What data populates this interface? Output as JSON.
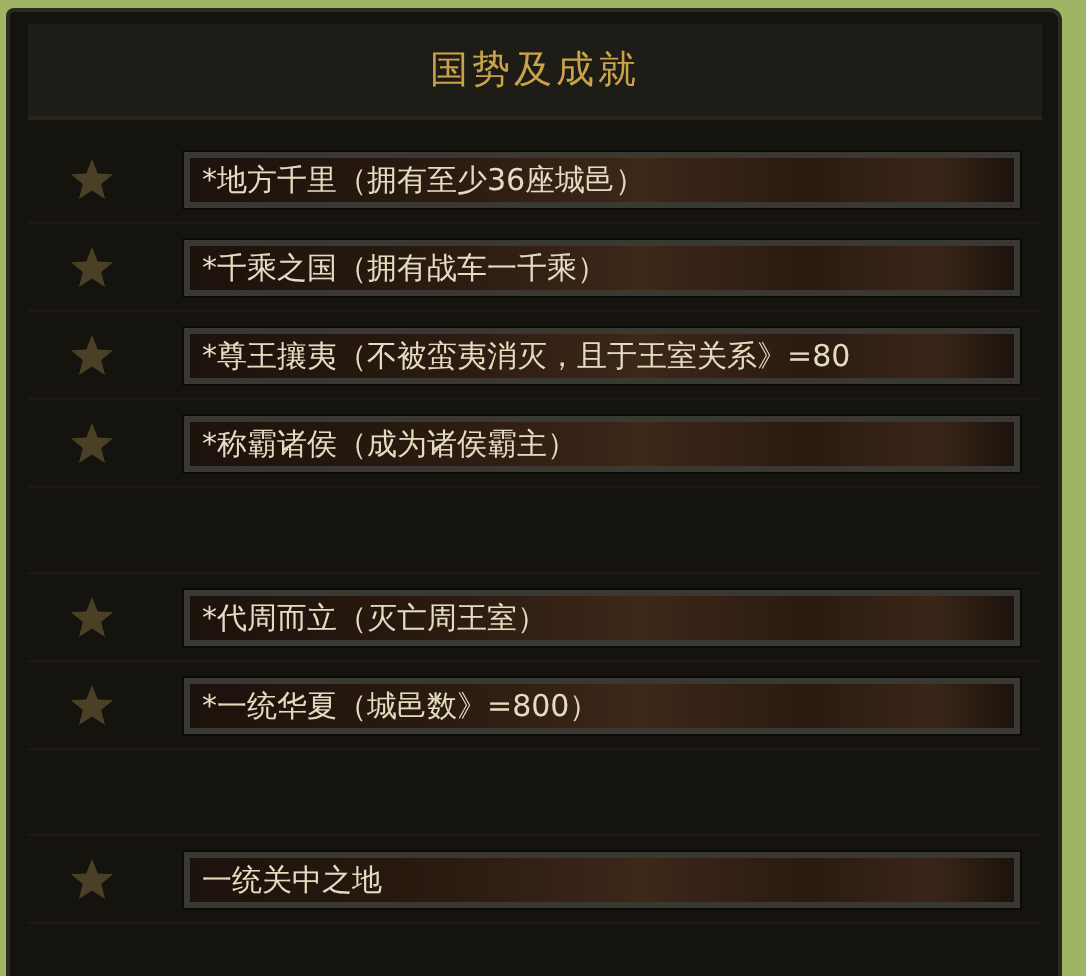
{
  "title": "国势及成就",
  "rows": [
    {
      "kind": "achievement",
      "label": "*地方千里（拥有至少36座城邑）"
    },
    {
      "kind": "achievement",
      "label": "*千乘之国（拥有战车一千乘）"
    },
    {
      "kind": "achievement",
      "label": "*尊王攘夷（不被蛮夷消灭，且于王室关系》=80"
    },
    {
      "kind": "achievement",
      "label": "*称霸诸侯（成为诸侯霸主）"
    },
    {
      "kind": "blank"
    },
    {
      "kind": "achievement",
      "label": "*代周而立（灭亡周王室）"
    },
    {
      "kind": "achievement",
      "label": "*一统华夏（城邑数》=800）"
    },
    {
      "kind": "blank"
    },
    {
      "kind": "achievement",
      "label": "一统关中之地"
    }
  ]
}
